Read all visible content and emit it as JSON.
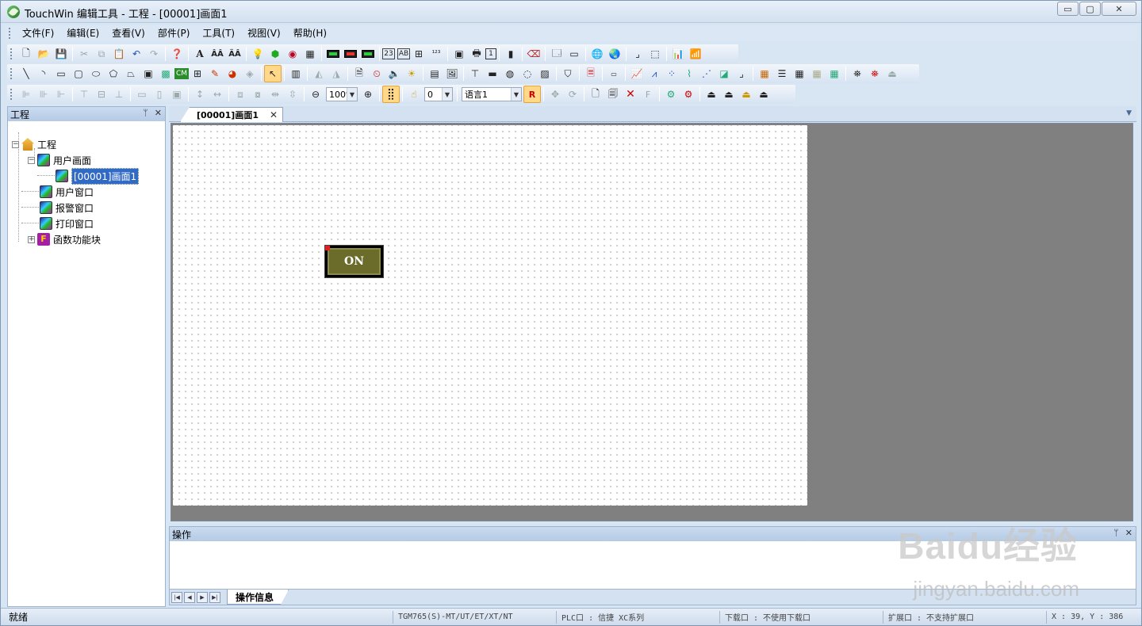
{
  "window": {
    "title": "TouchWin 编辑工具 - 工程 - [00001]画面1",
    "min_glyph": "▭",
    "max_glyph": "▢",
    "close_glyph": "✕"
  },
  "menu": {
    "items": [
      "文件(F)",
      "编辑(E)",
      "查看(V)",
      "部件(P)",
      "工具(T)",
      "视图(V)",
      "帮助(H)"
    ]
  },
  "toolbar": {
    "zoom_value": "100%",
    "pen_value": "0",
    "language_value": "语言1"
  },
  "project_panel": {
    "title": "工程",
    "pin_glyph": "📌",
    "close_glyph": "✕",
    "tree": {
      "root": "工程",
      "user_screens": "用户画面",
      "screen1": "[00001]画面1",
      "user_windows": "用户窗口",
      "alarm_windows": "报警窗口",
      "print_windows": "打印窗口",
      "function_blocks": "函数功能块"
    }
  },
  "editor": {
    "tab_label": "[00001]画面1",
    "on_button_text": "ON"
  },
  "output_panel": {
    "title": "操作",
    "tab_label": "操作信息"
  },
  "statusbar": {
    "ready": "就绪",
    "device": "TGM765(S)-MT/UT/ET/XT/NT",
    "plc_port": "PLC口 : 信捷 XC系列",
    "download_port": "下载口 : 不使用下载口",
    "extension_port": "扩展口 : 不支持扩展口",
    "coords": "X : 39, Y : 386"
  },
  "watermark": {
    "brand": "Baidu经验",
    "url": "jingyan.baidu.com"
  },
  "colors": {
    "selection": "#316ac5",
    "canvas_bg": "#808080",
    "on_button": "#6b6b2a"
  }
}
